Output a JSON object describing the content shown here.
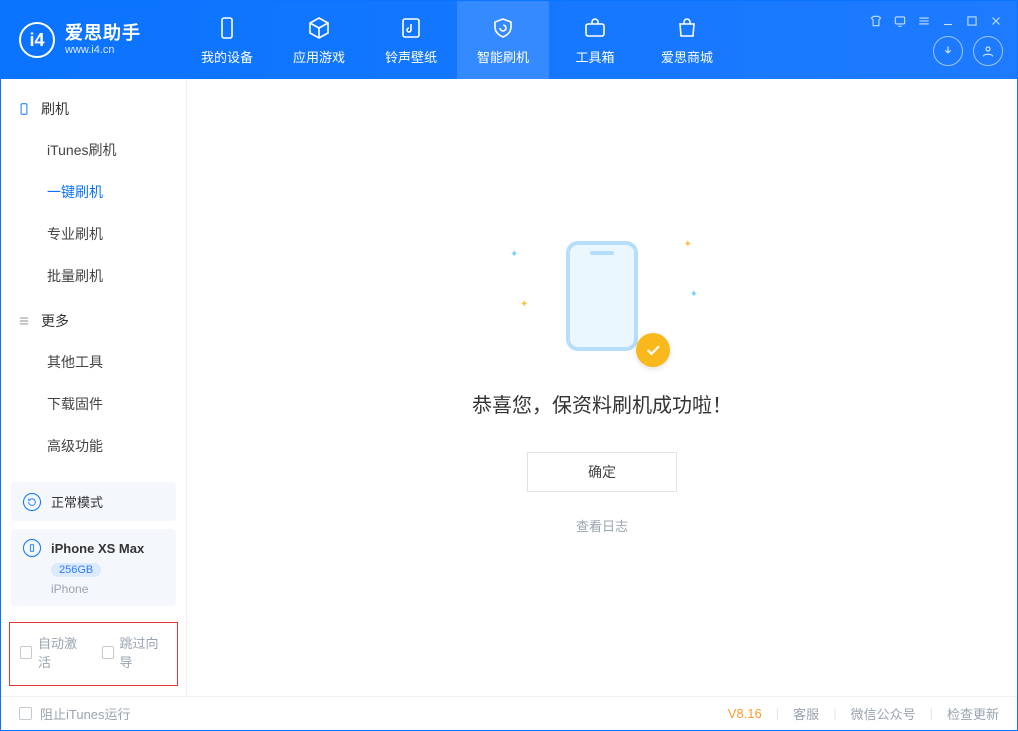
{
  "app": {
    "name_cn": "爱思助手",
    "name_en": "www.i4.cn"
  },
  "tabs": {
    "device": "我的设备",
    "apps": "应用游戏",
    "ring": "铃声壁纸",
    "flash": "智能刷机",
    "toolbox": "工具箱",
    "store": "爱思商城"
  },
  "sidebar": {
    "group_flash": "刷机",
    "items_flash": {
      "itunes": "iTunes刷机",
      "onekey": "一键刷机",
      "pro": "专业刷机",
      "batch": "批量刷机"
    },
    "group_more": "更多",
    "items_more": {
      "other": "其他工具",
      "firmware": "下载固件",
      "advanced": "高级功能"
    }
  },
  "device": {
    "mode": "正常模式",
    "name": "iPhone XS Max",
    "storage": "256GB",
    "type": "iPhone"
  },
  "options": {
    "auto_activate": "自动激活",
    "skip_guide": "跳过向导"
  },
  "main": {
    "success": "恭喜您，保资料刷机成功啦！",
    "ok": "确定",
    "viewlog": "查看日志"
  },
  "status": {
    "block_itunes": "阻止iTunes运行",
    "version": "V8.16",
    "service": "客服",
    "wechat": "微信公众号",
    "update": "检查更新"
  }
}
